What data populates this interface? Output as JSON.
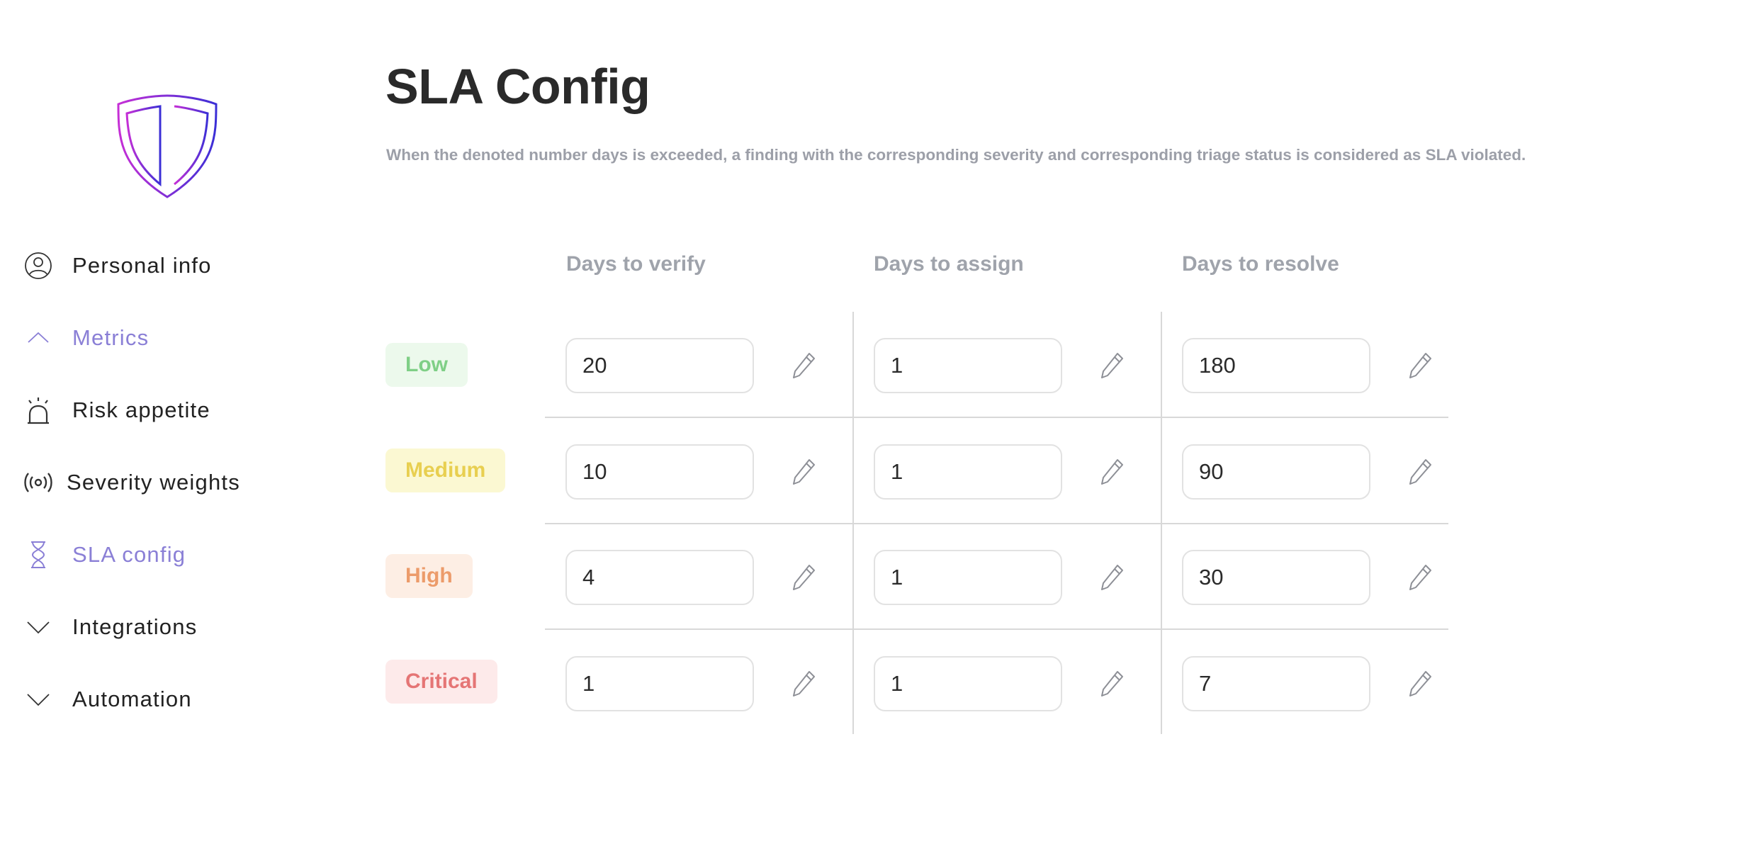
{
  "colors": {
    "accent": "#8a7fd6",
    "logo_gradient_start": "#c62fd6",
    "logo_gradient_end": "#3b2fd6",
    "low": "#7fcf86",
    "medium": "#e8cf50",
    "high": "#ec9b6a",
    "critical": "#e57575"
  },
  "sidebar": {
    "logo_icon": "shield-logo",
    "items": [
      {
        "label": "Personal info",
        "icon": "user-circle-icon"
      },
      {
        "label": "Metrics",
        "icon": "chevron-up-icon"
      },
      {
        "label": "Risk appetite",
        "icon": "alarm-bell-icon"
      },
      {
        "label": "Severity weights",
        "icon": "broadcast-icon"
      },
      {
        "label": "SLA config",
        "icon": "hourglass-icon"
      },
      {
        "label": "Integrations",
        "icon": "chevron-down-icon"
      },
      {
        "label": "Automation",
        "icon": "chevron-down-icon"
      }
    ]
  },
  "main": {
    "title": "SLA Config",
    "description": "When the denoted number days is exceeded, a finding with the corresponding severity and corresponding triage status is considered as SLA violated.",
    "columns": [
      "Days to verify",
      "Days to assign",
      "Days to resolve"
    ],
    "rows": [
      {
        "severity": "Low",
        "values": [
          "20",
          "1",
          "180"
        ]
      },
      {
        "severity": "Medium",
        "values": [
          "10",
          "1",
          "90"
        ]
      },
      {
        "severity": "High",
        "values": [
          "4",
          "1",
          "30"
        ]
      },
      {
        "severity": "Critical",
        "values": [
          "1",
          "1",
          "7"
        ]
      }
    ],
    "edit_icon": "pencil-icon"
  }
}
